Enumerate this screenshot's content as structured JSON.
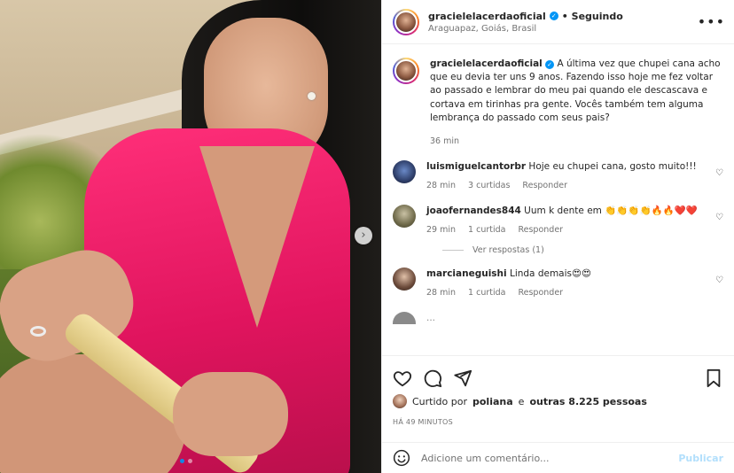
{
  "post": {
    "username": "gracielelacerdaoficial",
    "follow_status": "• Seguindo",
    "location": "Araguapaz, Goiás, Brasil",
    "more_icon": "more-icon"
  },
  "photo": {
    "carousel_index": 1,
    "carousel_count": 2,
    "next_icon": "›"
  },
  "caption": {
    "username": "gracielelacerdaoficial",
    "text": "A última vez que chupei cana acho que eu devia ter uns 9 anos. Fazendo isso hoje me fez voltar ao passado e lembrar do meu pai quando ele descascava e cortava em tirinhas pra gente. Vocês também tem alguma lembrança do passado com seus pais?",
    "time": "36 min"
  },
  "comments": [
    {
      "username": "luismiguelcantorbr",
      "text": "Hoje eu chupei cana, gosto muito!!!",
      "time": "28 min",
      "likes": "3 curtidas",
      "reply": "Responder"
    },
    {
      "username": "joaofernandes844",
      "text": "Uum k dente em 👏👏👏👏🔥🔥❤️❤️",
      "time": "29 min",
      "likes": "1 curtida",
      "reply": "Responder"
    },
    {
      "username": "marcianeguishi",
      "text": "Linda demais😍😍",
      "time": "28 min",
      "likes": "1 curtida",
      "reply": "Responder"
    }
  ],
  "view_replies": "Ver respostas (1)",
  "cut_comment": "...",
  "likes": {
    "text_prefix": "Curtido por",
    "user": "poliana",
    "text_mid": "e",
    "others": "outras 8.225 pessoas"
  },
  "timestamp": "HÁ 49 MINUTOS",
  "add_comment": {
    "placeholder": "Adicione um comentário...",
    "publish": "Publicar"
  },
  "colors": {
    "accent": "#0095f6",
    "dress": "#e0145e",
    "publish_disabled": "#b2dffc"
  }
}
